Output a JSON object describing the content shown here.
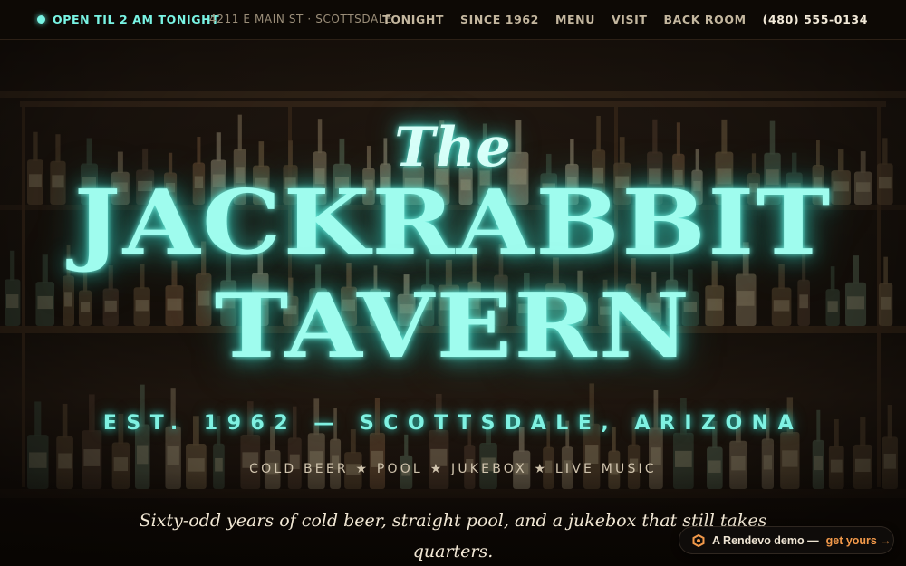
{
  "topbar": {
    "status_text": "OPEN TIL 2 AM TONIGHT",
    "address": "4211 E MAIN ST · SCOTTSDALE",
    "nav": [
      "TONIGHT",
      "SINCE 1962",
      "MENU",
      "VISIT",
      "BACK ROOM"
    ],
    "phone": "(480) 555-0134"
  },
  "hero": {
    "the": "The",
    "title_line1": "JACKRABBIT",
    "title_line2": "TAVERN",
    "established": "EST. 1962 — SCOTTSDALE, ARIZONA",
    "features": "COLD BEER ★ POOL ★ JUKEBOX ★ LIVE MUSIC",
    "tagline_line1": "Sixty-odd years of cold beer, straight pool, and a jukebox that still takes",
    "tagline_line2": "quarters."
  },
  "badge": {
    "text": "A Rendevo demo —",
    "link": "get yours →"
  },
  "colors": {
    "neon": "#9ffcee",
    "accent_orange": "#f2994a",
    "topbar_bg": "#0e0905"
  },
  "icons": {
    "status": "status-dot-icon",
    "badge": "rendevo-logo-icon"
  }
}
